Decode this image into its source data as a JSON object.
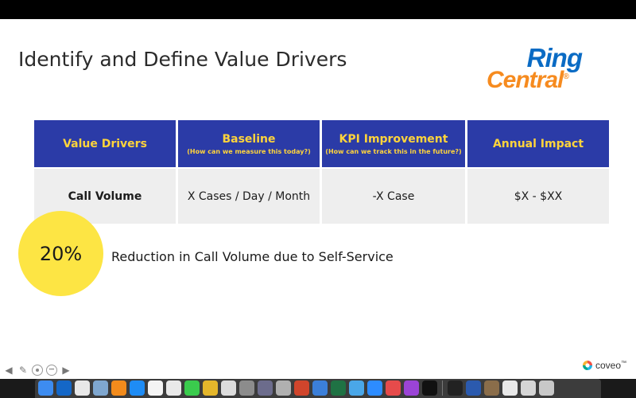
{
  "slide": {
    "title": "Identify and Define Value Drivers",
    "logo": {
      "line1": "Ring",
      "line2": "Central",
      "reg": "®",
      "color_ring": "#0a6bc4",
      "color_central": "#f68b1f"
    }
  },
  "table": {
    "headers": [
      {
        "label": "Value Drivers",
        "sub": ""
      },
      {
        "label": "Baseline",
        "sub": "(How can we measure this today?)"
      },
      {
        "label": "KPI Improvement",
        "sub": "(How can we track this in the future?)"
      },
      {
        "label": "Annual Impact",
        "sub": ""
      }
    ],
    "row": [
      "Call Volume",
      "X Cases / Day / Month",
      "-X Case",
      "$X - $XX"
    ],
    "header_color": "#2b3ba7",
    "header_text_color": "#ffd43b"
  },
  "stat": {
    "value": "20%",
    "text": "Reduction in Call Volume due to Self-Service",
    "circle_color": "#fde544"
  },
  "controls": {
    "prev": "◀",
    "pen": "✎",
    "dots": "•••",
    "next": "▶"
  },
  "brand": {
    "name": "coveo",
    "tm": "™"
  },
  "dock": {
    "apps": [
      {
        "name": "finder",
        "color": "#3d8cf0"
      },
      {
        "name": "outlook",
        "color": "#1467c7"
      },
      {
        "name": "slack",
        "color": "#e8e8e8"
      },
      {
        "name": "preview",
        "color": "#7fa7cf"
      },
      {
        "name": "app-orange",
        "color": "#f28b1c"
      },
      {
        "name": "app-store",
        "color": "#1e8cf5"
      },
      {
        "name": "calendar",
        "color": "#f4f4f4"
      },
      {
        "name": "reminders",
        "color": "#e9e9e9"
      },
      {
        "name": "messages",
        "color": "#3acb4d"
      },
      {
        "name": "photos",
        "color": "#e4b62b"
      },
      {
        "name": "chrome",
        "color": "#dcdcdc"
      },
      {
        "name": "system-preferences",
        "color": "#8c8c8c"
      },
      {
        "name": "launchpad",
        "color": "#6c6c8c"
      },
      {
        "name": "safari",
        "color": "#b0b0b0"
      },
      {
        "name": "powerpoint",
        "color": "#d0452c"
      },
      {
        "name": "xcode",
        "color": "#3b7fd9"
      },
      {
        "name": "excel",
        "color": "#1f7244"
      },
      {
        "name": "app-blue",
        "color": "#4aa7e8"
      },
      {
        "name": "zoom",
        "color": "#2d8cff"
      },
      {
        "name": "app-red",
        "color": "#e64b4b"
      },
      {
        "name": "podcasts",
        "color": "#9b44d6"
      },
      {
        "name": "apple-tv",
        "color": "#111111"
      },
      {
        "name": "terminal",
        "color": "#222222"
      },
      {
        "name": "word",
        "color": "#2b5aae"
      },
      {
        "name": "app-brown",
        "color": "#8a6d4a"
      },
      {
        "name": "window-a",
        "color": "#e8e8e8"
      },
      {
        "name": "window-b",
        "color": "#d5d5d5"
      },
      {
        "name": "trash",
        "color": "#c8c8c8"
      }
    ]
  }
}
